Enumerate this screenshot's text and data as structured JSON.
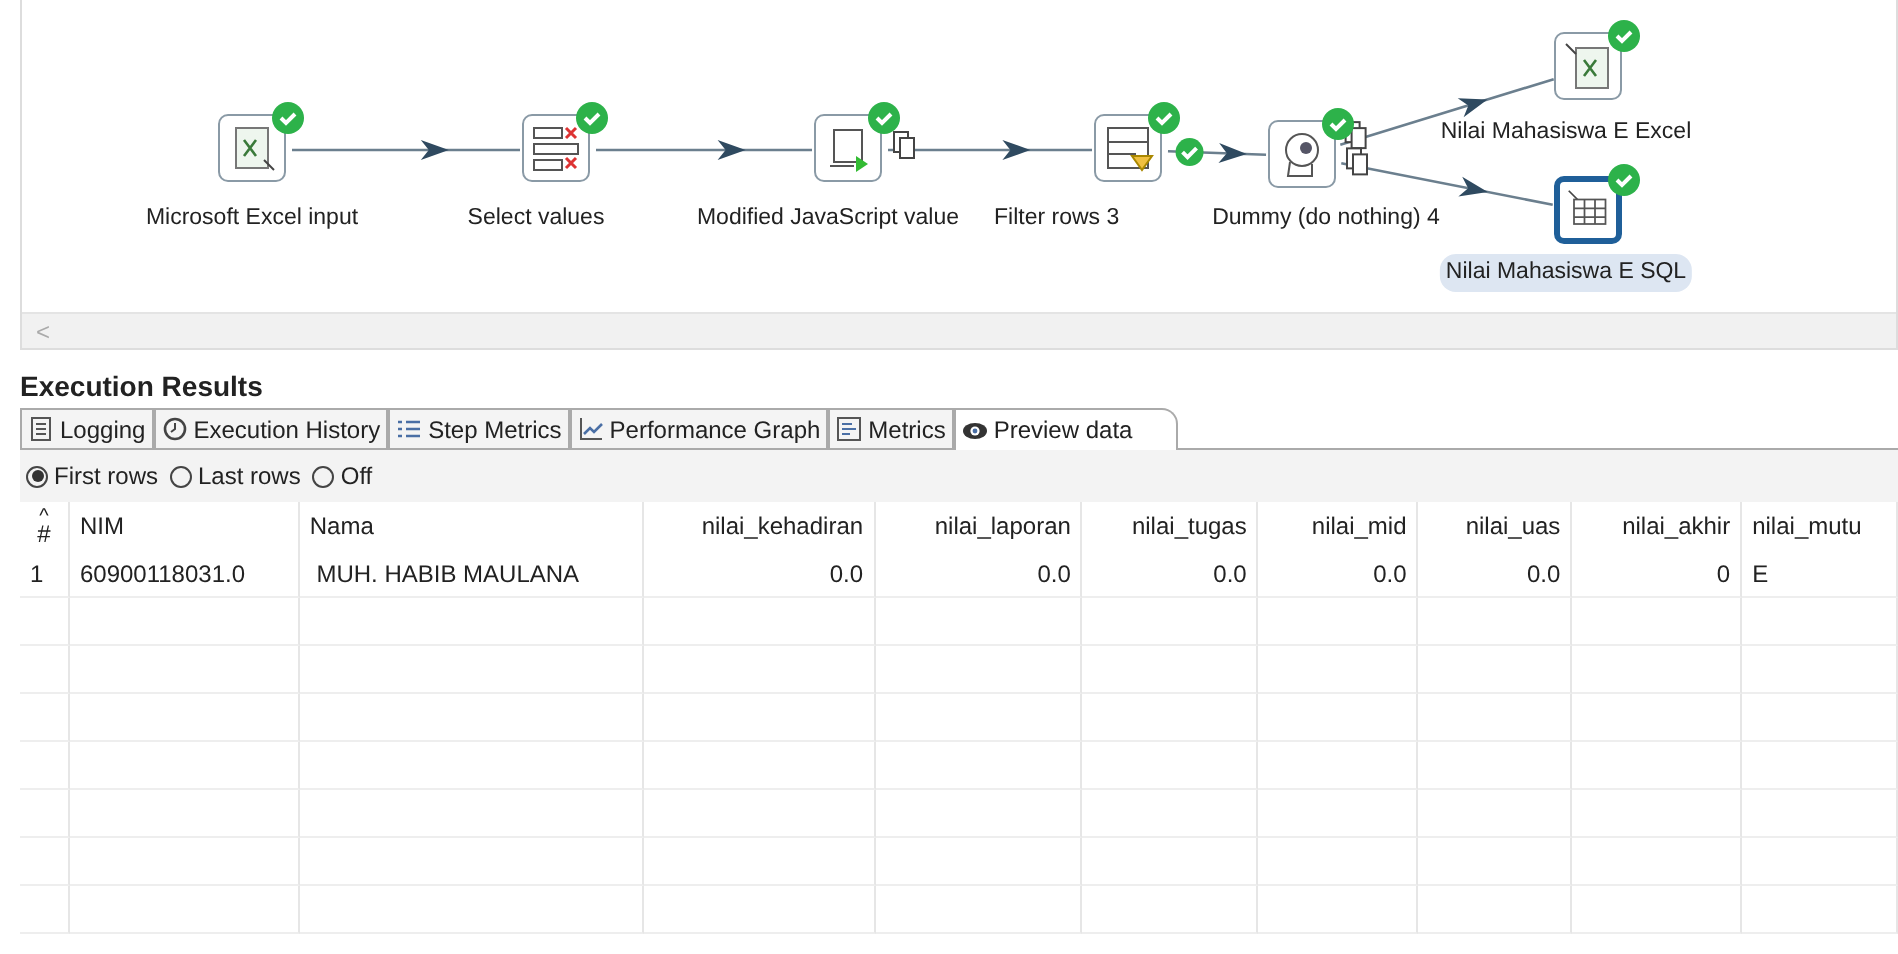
{
  "canvas": {
    "nodes": [
      {
        "label": "Microsoft Excel input",
        "kind": "excel-in",
        "ok": true,
        "selected": false
      },
      {
        "label": "Select values",
        "kind": "select",
        "ok": true,
        "selected": false
      },
      {
        "label": "Modified JavaScript value",
        "kind": "script",
        "ok": true,
        "selected": false
      },
      {
        "label": "Filter rows 3",
        "kind": "filter",
        "ok": true,
        "selected": false
      },
      {
        "label": "Dummy (do nothing) 4",
        "kind": "dummy",
        "ok": true,
        "selected": false
      },
      {
        "label": "Nilai Mahasiswa E Excel",
        "kind": "excel-out",
        "ok": true,
        "selected": false
      },
      {
        "label": "Nilai Mahasiswa E SQL",
        "kind": "table-out",
        "ok": true,
        "selected": true
      }
    ],
    "hops": [
      {
        "copy": false,
        "ok": false
      },
      {
        "copy": false,
        "ok": false
      },
      {
        "copy": true,
        "ok": false
      },
      {
        "copy": false,
        "ok": true
      },
      {
        "copy": true,
        "ok": false
      },
      {
        "copy": true,
        "ok": false
      }
    ],
    "scroll_left": "<"
  },
  "results": {
    "title": "Execution Results",
    "tabs": [
      {
        "label": "Logging",
        "selected": false
      },
      {
        "label": "Execution History",
        "selected": false
      },
      {
        "label": "Step Metrics",
        "selected": false
      },
      {
        "label": "Performance Graph",
        "selected": false
      },
      {
        "label": "Metrics",
        "selected": false
      },
      {
        "label": "Preview data",
        "selected": true
      }
    ],
    "radios": [
      {
        "label": "First rows",
        "selected": true
      },
      {
        "label": "Last rows",
        "selected": false
      },
      {
        "label": "Off",
        "selected": false
      }
    ],
    "table": {
      "sort_mark": "^",
      "columns": [
        "#",
        "NIM",
        "Nama",
        "nilai_kehadiran",
        "nilai_laporan",
        "nilai_tugas",
        "nilai_mid",
        "nilai_uas",
        "nilai_akhir",
        "nilai_mutu"
      ],
      "rows": [
        [
          "1",
          "60900118031.0",
          " MUH. HABIB MAULANA",
          "0.0",
          "0.0",
          "0.0",
          "0.0",
          "0.0",
          "0",
          "E"
        ]
      ]
    }
  }
}
